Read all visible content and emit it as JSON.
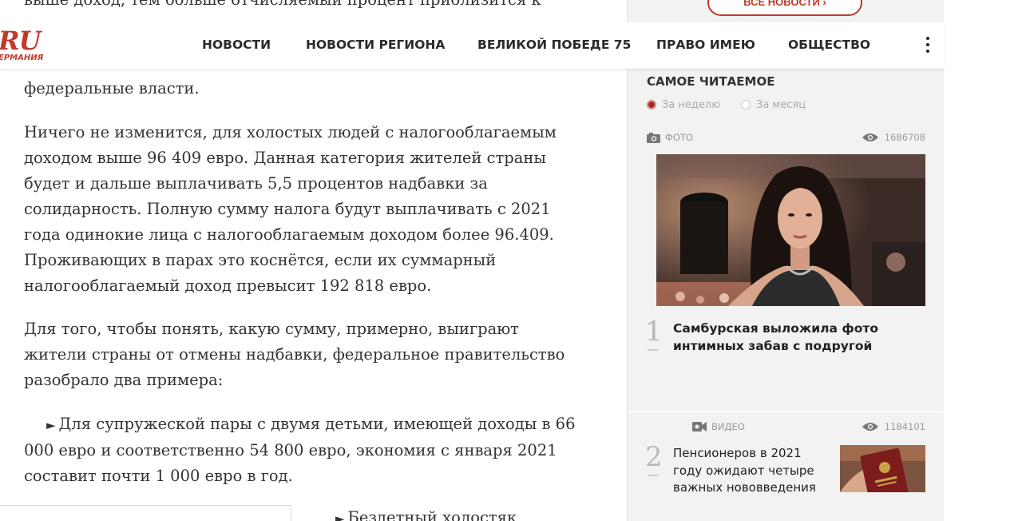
{
  "nav": {
    "logo_text": "RU",
    "logo_sub": "ЕРМАНИЯ",
    "items": [
      "НОВОСТИ",
      "НОВОСТИ РЕГИОНА",
      "ВЕЛИКОЙ ПОБЕДЕ 75",
      "ПРАВО ИМЕЮ",
      "ОБЩЕСТВО"
    ],
    "more_icon": "kebab-menu-icon"
  },
  "article": {
    "p0": "выше доход, тем больше отчисляемый процент приблизится к",
    "p1": "федеральные власти.",
    "p2": "Ничего не изменится, для холостых людей с налогооблагаемым доходом выше 96 409 евро. Данная категория жителей страны будет и дальше выплачивать 5,5 процентов надбавки за солидарность. Полную сумму налога будут выплачивать с 2021 года одинокие лица с налогооблагаемым доходом более 96.409. Проживающих в парах это коснётся, если их суммарный налогооблагаемый доход превысит 192 818 евро.",
    "p3": "Для того, чтобы понять, какую сумму, примерно, выиграют жители страны от отмены надбавки, федеральное правительство разобрало два примера:",
    "bullet": "►",
    "p4": "Для супружеской пары с двумя детьми, имеющей доходы в 66 000 евро и соответственно 54 800 евро, экономия с января 2021 составит почти 1 000 евро в год.",
    "p5": "Бездетный холостяк"
  },
  "sidebar": {
    "all_news_label": "ВСЕ НОВОСТИ ›",
    "most_read_title": "САМОЕ ЧИТАЕМОЕ",
    "filters": [
      {
        "label": "За неделю",
        "selected": true
      },
      {
        "label": "За месяц",
        "selected": false
      }
    ],
    "items": [
      {
        "rank": "1",
        "kind": "ФОТО",
        "kind_icon": "camera-icon",
        "views": "1686708",
        "title": "Самбурская выложила фото интимных забав с подругой"
      },
      {
        "rank": "2",
        "kind": "ВИДЕО",
        "kind_icon": "video-camera-icon",
        "views": "1184101",
        "title": "Пенсионеров в 2021 году ожидают четыре важных нововведения"
      }
    ]
  },
  "colors": {
    "accent": "#c0392b",
    "sidebar_bg": "#f2f2f2",
    "text": "#333333"
  }
}
